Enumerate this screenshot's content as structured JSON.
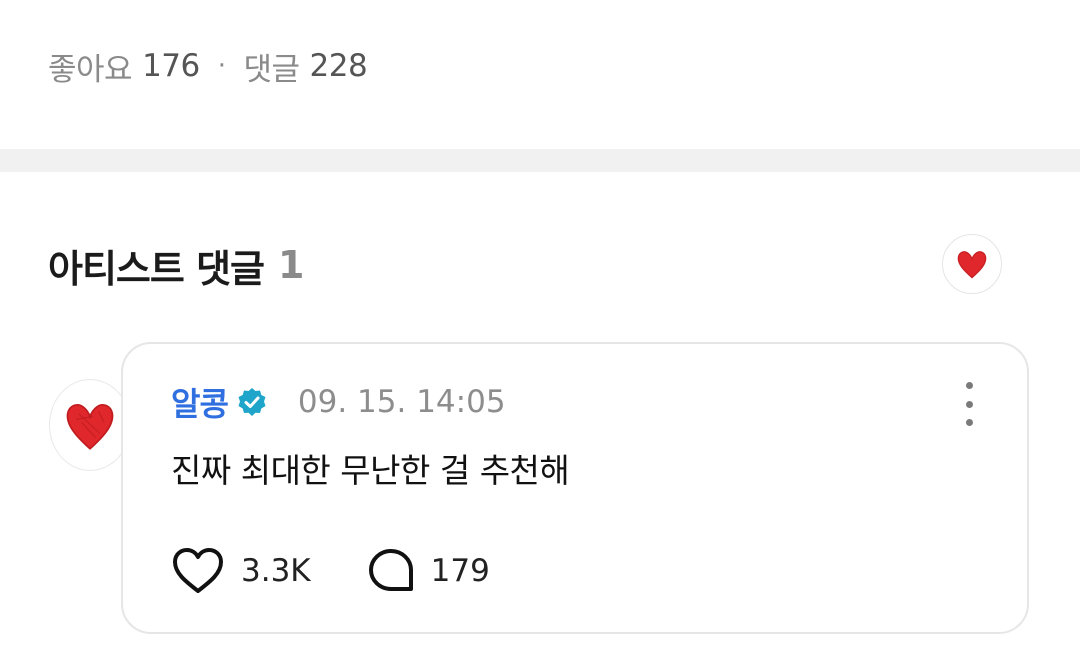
{
  "stats": {
    "like_label": "좋아요",
    "like_count": "176",
    "separator": "·",
    "comment_label": "댓글",
    "comment_count": "228"
  },
  "artist_comments": {
    "title": "아티스트 댓글",
    "count": "1"
  },
  "comment": {
    "author": "알콩",
    "timestamp": "09. 15. 14:05",
    "text": "진짜 최대한 무난한 걸 추천해",
    "likes": "3.3K",
    "replies": "179"
  },
  "colors": {
    "author": "#2f6fe0",
    "verified_badge": "#1ea5c9",
    "heart_avatar": "#e0282c",
    "divider_band": "#f1f1f1"
  },
  "icons": {
    "verified": "verified-badge-icon",
    "more": "more-vertical-icon",
    "like": "heart-outline-icon",
    "reply": "speech-bubble-icon",
    "avatar": "red-heart-icon"
  }
}
